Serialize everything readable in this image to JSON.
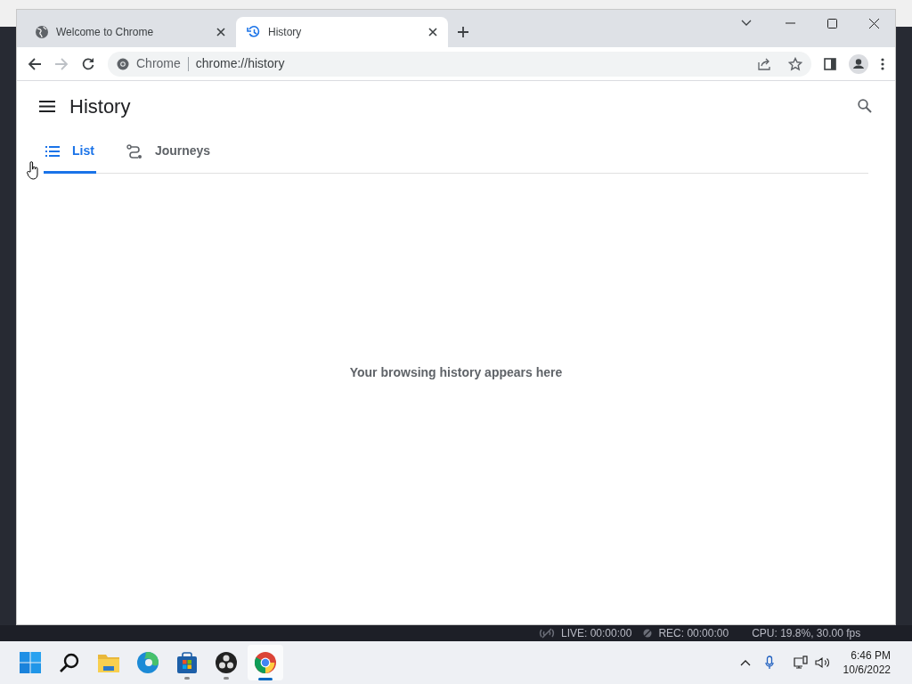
{
  "browser": {
    "tabs": [
      {
        "title": "Welcome to Chrome",
        "kind": "globe",
        "selected": false
      },
      {
        "title": "History",
        "kind": "history",
        "selected": true
      }
    ],
    "omnibox": {
      "site": "Chrome",
      "url": "chrome://history"
    }
  },
  "page": {
    "title": "History",
    "tabs": [
      {
        "label": "List",
        "kind": "list",
        "selected": true
      },
      {
        "label": "Journeys",
        "kind": "journeys",
        "selected": false
      }
    ],
    "empty_message": "Your browsing history appears here"
  },
  "obs_status": {
    "live": "LIVE: 00:00:00",
    "rec": "REC: 00:00:00",
    "cpu": "CPU: 19.8%, 30.00 fps"
  },
  "taskbar": {
    "apps": [
      {
        "kind": "start",
        "running": false,
        "selected": false
      },
      {
        "kind": "search",
        "running": false,
        "selected": false
      },
      {
        "kind": "explorer",
        "running": false,
        "selected": false
      },
      {
        "kind": "edge",
        "running": false,
        "selected": false
      },
      {
        "kind": "store",
        "running": true,
        "selected": false
      },
      {
        "kind": "obs",
        "running": true,
        "selected": false
      },
      {
        "kind": "chrome",
        "running": true,
        "selected": true
      }
    ],
    "time": "6:46 PM",
    "date": "10/6/2022"
  }
}
